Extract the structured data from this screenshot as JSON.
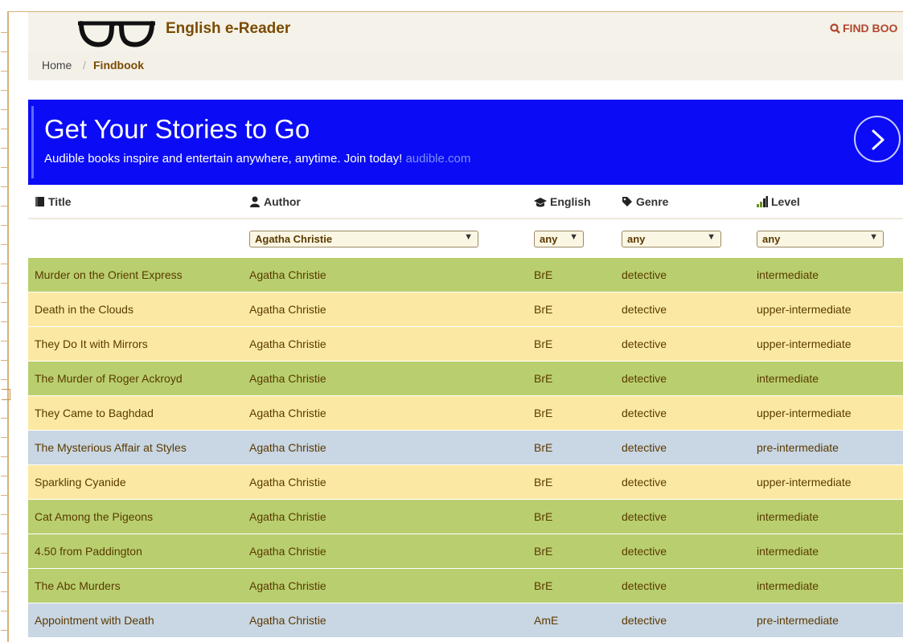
{
  "app": {
    "brand": "English e-Reader",
    "find_book": "FIND BOO"
  },
  "breadcrumb": {
    "home": "Home",
    "separator": "/",
    "current": "Findbook"
  },
  "banner": {
    "headline": "Get Your Stories to Go",
    "tagline": "Audible books inspire and entertain anywhere, anytime. Join today!",
    "link": "audible.com"
  },
  "table": {
    "headers": {
      "title": "Title",
      "author": "Author",
      "english": "English",
      "genre": "Genre",
      "level": "Level"
    },
    "filters": {
      "author": "Agatha Christie",
      "english": "any",
      "genre": "any",
      "level": "any"
    },
    "rows": [
      {
        "title": "Murder on the Orient Express",
        "author": "Agatha Christie",
        "english": "BrE",
        "genre": "detective",
        "level": "intermediate"
      },
      {
        "title": "Death in the Clouds",
        "author": "Agatha Christie",
        "english": "BrE",
        "genre": "detective",
        "level": "upper-intermediate"
      },
      {
        "title": "They Do It with Mirrors",
        "author": "Agatha Christie",
        "english": "BrE",
        "genre": "detective",
        "level": "upper-intermediate"
      },
      {
        "title": "The Murder of Roger Ackroyd",
        "author": "Agatha Christie",
        "english": "BrE",
        "genre": "detective",
        "level": "intermediate"
      },
      {
        "title": "They Came to Baghdad",
        "author": "Agatha Christie",
        "english": "BrE",
        "genre": "detective",
        "level": "upper-intermediate"
      },
      {
        "title": "The Mysterious Affair at Styles",
        "author": "Agatha Christie",
        "english": "BrE",
        "genre": "detective",
        "level": "pre-intermediate"
      },
      {
        "title": "Sparkling Cyanide",
        "author": "Agatha Christie",
        "english": "BrE",
        "genre": "detective",
        "level": "upper-intermediate"
      },
      {
        "title": "Cat Among the Pigeons",
        "author": "Agatha Christie",
        "english": "BrE",
        "genre": "detective",
        "level": "intermediate"
      },
      {
        "title": "4.50 from Paddington",
        "author": "Agatha Christie",
        "english": "BrE",
        "genre": "detective",
        "level": "intermediate"
      },
      {
        "title": "The Abc Murders",
        "author": "Agatha Christie",
        "english": "BrE",
        "genre": "detective",
        "level": "intermediate"
      },
      {
        "title": "Appointment with Death",
        "author": "Agatha Christie",
        "english": "AmE",
        "genre": "detective",
        "level": "pre-intermediate"
      }
    ]
  },
  "colors": {
    "banner": "#0b0cf5",
    "intermediate": "#b9cf6f",
    "upper_intermediate": "#fbe9a3",
    "pre_intermediate": "#c9d6e3"
  },
  "icons": {
    "logo": "glasses-icon",
    "find": "search-icon",
    "banner_next": "chevron-right-icon",
    "title": "book-icon",
    "author": "user-icon",
    "english": "graduation-cap-icon",
    "genre": "tag-icon",
    "level": "signal-bars-icon"
  }
}
